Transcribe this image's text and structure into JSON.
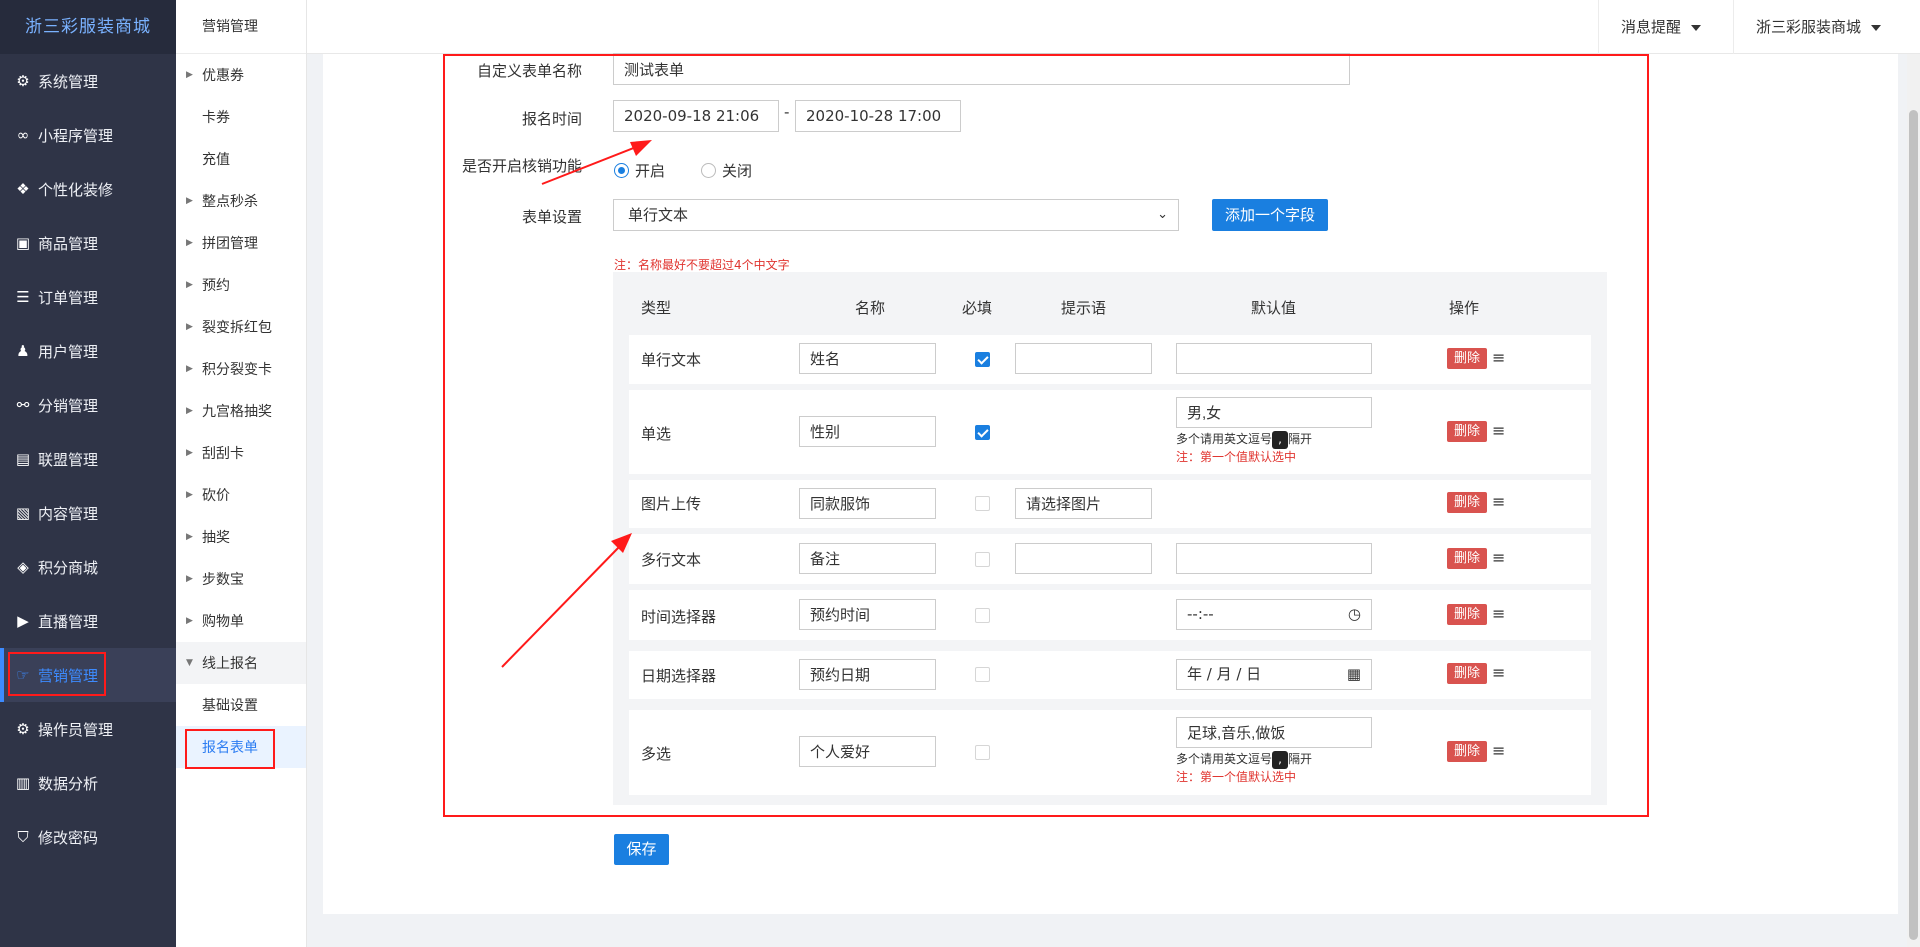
{
  "app": {
    "brand": "浙三彩服装商城"
  },
  "sidebar": {
    "items": [
      {
        "label": "系统管理",
        "icon": "⚙"
      },
      {
        "label": "小程序管理",
        "icon": "∞"
      },
      {
        "label": "个性化装修",
        "icon": "❖"
      },
      {
        "label": "商品管理",
        "icon": "▣"
      },
      {
        "label": "订单管理",
        "icon": "☰"
      },
      {
        "label": "用户管理",
        "icon": "♟"
      },
      {
        "label": "分销管理",
        "icon": "⚯"
      },
      {
        "label": "联盟管理",
        "icon": "▤"
      },
      {
        "label": "内容管理",
        "icon": "▧"
      },
      {
        "label": "积分商城",
        "icon": "◈"
      },
      {
        "label": "直播管理",
        "icon": "▶"
      },
      {
        "label": "营销管理",
        "icon": "☞"
      },
      {
        "label": "操作员管理",
        "icon": "⚙"
      },
      {
        "label": "数据分析",
        "icon": "▥"
      },
      {
        "label": "修改密码",
        "icon": "⛉"
      }
    ]
  },
  "subnav": {
    "title": "营销管理",
    "items": [
      {
        "label": "优惠券"
      },
      {
        "label": "卡券"
      },
      {
        "label": "充值"
      },
      {
        "label": "整点秒杀"
      },
      {
        "label": "拼团管理"
      },
      {
        "label": "预约"
      },
      {
        "label": "裂变拆红包"
      },
      {
        "label": "积分裂变卡"
      },
      {
        "label": "九宫格抽奖"
      },
      {
        "label": "刮刮卡"
      },
      {
        "label": "砍价"
      },
      {
        "label": "抽奖"
      },
      {
        "label": "步数宝"
      },
      {
        "label": "购物单"
      },
      {
        "label": "线上报名"
      },
      {
        "label": "基础设置"
      },
      {
        "label": "报名表单"
      }
    ]
  },
  "header": {
    "notify": "消息提醒",
    "account": "浙三彩服装商城"
  },
  "form": {
    "name_label": "自定义表单名称",
    "name_value": "测试表单",
    "time_label": "报名时间",
    "start_time": "2020-09-18 21:06",
    "time_sep": "-",
    "end_time": "2020-10-28 17:00",
    "verify_label": "是否开启核销功能",
    "verify_on": "开启",
    "verify_off": "关闭",
    "settings_label": "表单设置",
    "field_type_selected": "单行文本",
    "add_field_button": "添加一个字段",
    "note": "注：名称最好不要超过4个中文字",
    "save_button": "保存"
  },
  "table": {
    "headers": {
      "type": "类型",
      "name": "名称",
      "required": "必填",
      "hint": "提示语",
      "default": "默认值",
      "action": "操作"
    },
    "delete_label": "删除",
    "multi_hint_prefix": "多个请用英文逗号",
    "multi_hint_comma": ",",
    "multi_hint_suffix": "隔开",
    "first_default_note": "注：第一个值默认选中",
    "rows": [
      {
        "type": "单行文本",
        "name": "姓名",
        "required": true,
        "hint": "",
        "default": ""
      },
      {
        "type": "单选",
        "name": "性别",
        "required": true,
        "default": "男,女"
      },
      {
        "type": "图片上传",
        "name": "同款服饰",
        "required": false,
        "hint": "请选择图片"
      },
      {
        "type": "多行文本",
        "name": "备注",
        "required": false,
        "hint": "",
        "default": ""
      },
      {
        "type": "时间选择器",
        "name": "预约时间",
        "required": false,
        "default": "--:--"
      },
      {
        "type": "日期选择器",
        "name": "预约日期",
        "required": false,
        "default": "年 / 月 / 日"
      },
      {
        "type": "多选",
        "name": "个人爱好",
        "required": false,
        "default": "足球,音乐,做饭"
      }
    ]
  },
  "colors": {
    "sidebar_bg": "#2f3447",
    "accent_blue": "#1a7fe0",
    "delete_red": "#d9534f",
    "annotation_red": "#ff1a1a"
  }
}
